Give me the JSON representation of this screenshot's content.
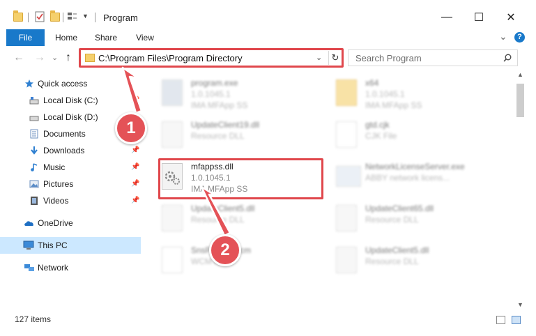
{
  "window": {
    "title": "Program",
    "minimize_glyph": "—",
    "maximize_glyph": "☐",
    "close_glyph": "✕"
  },
  "ribbon": {
    "tabs": [
      "File",
      "Home",
      "Share",
      "View"
    ],
    "collapse_glyph": "⌄",
    "help_glyph": "?"
  },
  "address": {
    "path": "C:\\Program Files\\Program Directory",
    "back_glyph": "←",
    "forward_glyph": "→",
    "up_glyph": "↑",
    "recent_glyph": "⌄",
    "dropdown_glyph": "⌄",
    "refresh_glyph": "↻"
  },
  "search": {
    "placeholder": "Search Program"
  },
  "sidebar": {
    "items": [
      {
        "label": "Quick access",
        "icon": "star-icon",
        "pinned": false
      },
      {
        "label": "Local Disk (C:)",
        "icon": "drive-icon",
        "pinned": true
      },
      {
        "label": "Local Disk (D:)",
        "icon": "drive-icon",
        "pinned": false
      },
      {
        "label": "Documents",
        "icon": "documents-icon",
        "pinned": true
      },
      {
        "label": "Downloads",
        "icon": "download-icon",
        "pinned": true
      },
      {
        "label": "Music",
        "icon": "music-icon",
        "pinned": true
      },
      {
        "label": "Pictures",
        "icon": "pictures-icon",
        "pinned": true
      },
      {
        "label": "Videos",
        "icon": "videos-icon",
        "pinned": true
      },
      {
        "label": "OneDrive",
        "icon": "cloud-icon",
        "pinned": false
      },
      {
        "label": "This PC",
        "icon": "computer-icon",
        "pinned": false,
        "selected": true
      },
      {
        "label": "Network",
        "icon": "network-icon",
        "pinned": false
      }
    ],
    "pin_glyph": "📌"
  },
  "files": [
    {
      "name": "program.exe",
      "line2": "1.0.1045.1",
      "line3": "IMA MFApp SS",
      "icon": "exe-icon"
    },
    {
      "name": "x64",
      "line2": "1.0.1045.1",
      "line3": "IMA MFApp SS",
      "icon": "folder-icon"
    },
    {
      "name": "UpdateClient19.dll",
      "line2": "Resource DLL",
      "line3": "",
      "icon": "dll-icon"
    },
    {
      "name": "gtd.cjk",
      "line2": "CJK File",
      "line3": "",
      "icon": "file-icon"
    },
    {
      "name": "mfappss.dll",
      "line2": "1.0.1045.1",
      "line3": "IMA MFApp SS",
      "icon": "dll-icon",
      "highlighted": true
    },
    {
      "name": "NetworkLicenseServer.exe",
      "line2": "ABBY network licens...",
      "line3": "",
      "icon": "exe-icon"
    },
    {
      "name": "UpdateClient5.dll",
      "line2": "Resource DLL",
      "line3": "",
      "icon": "dll-icon"
    },
    {
      "name": "UpdateClient65.dll",
      "line2": "Resource DLL",
      "line3": "",
      "icon": "dll-icon"
    },
    {
      "name": "SnsPrivate.wcm",
      "line2": "WCM File",
      "line3": "",
      "icon": "file-icon"
    },
    {
      "name": "UpdateClient5.dll",
      "line2": "Resource DLL",
      "line3": "",
      "icon": "dll-icon"
    }
  ],
  "status": {
    "item_count": "127 items"
  },
  "callouts": {
    "step1": "1",
    "step2": "2",
    "color": "#e45257"
  },
  "colors": {
    "accent": "#1979ca",
    "highlight_box": "#e0474c",
    "selected_nav": "#cce8ff"
  }
}
